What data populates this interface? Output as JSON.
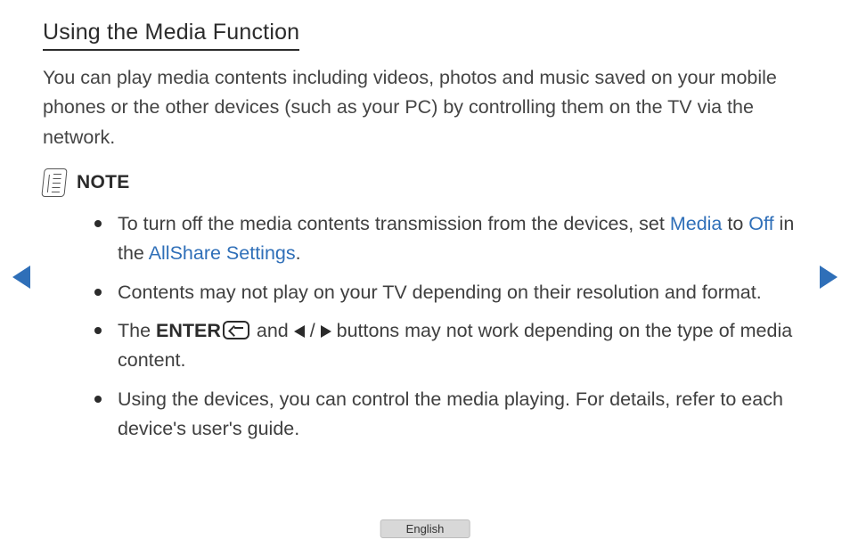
{
  "title": "Using the Media Function",
  "intro": "You can play media contents including videos, photos and music saved on your mobile phones or the other devices (such as your PC) by controlling them on the TV via the network.",
  "noteLabel": "NOTE",
  "notes": {
    "n1a": "To turn off the media contents transmission from the devices, set ",
    "n1_media": "Media",
    "n1b": " to ",
    "n1_off": "Off",
    "n1c": " in the ",
    "n1_link": "AllShare Settings",
    "n1d": ".",
    "n2": "Contents may not play on your TV depending on their resolution and format.",
    "n3a": "The ",
    "n3_enter": "ENTER",
    "n3b": " and ",
    "n3_slash": " / ",
    "n3c": " buttons may not work depending on the type of media content.",
    "n4": "Using the devices, you can control the media playing. For details, refer to each device's user's guide."
  },
  "language": "English"
}
